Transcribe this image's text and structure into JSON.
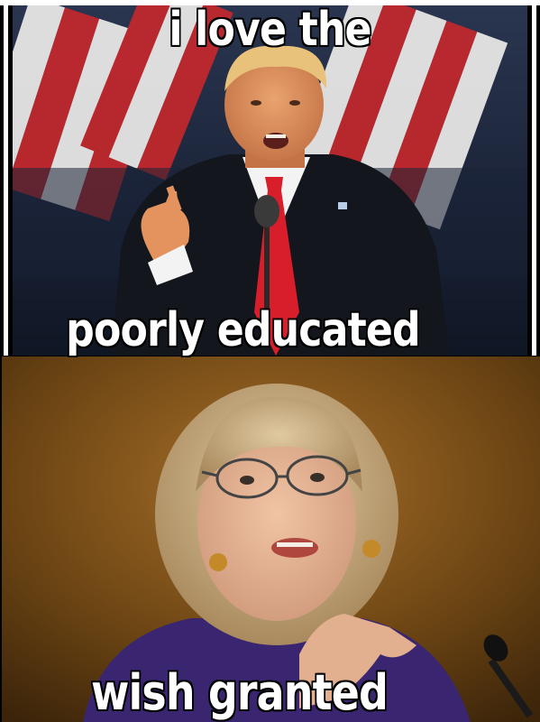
{
  "meme": {
    "caption_top": "i love the",
    "caption_middle": "poorly educated",
    "caption_bottom": "wish granted"
  },
  "colors": {
    "top_background": "#1b2436",
    "flag_red": "#c8282c",
    "flag_white": "#f2f0ee",
    "suit_dark": "#14161d",
    "tie_red": "#d81e2a",
    "bottom_background": "#7a4c16",
    "jacket_purple": "#3a2670",
    "hair_blonde": "#c9ad84",
    "caption_fill": "#ffffff",
    "caption_outline": "#000000"
  }
}
